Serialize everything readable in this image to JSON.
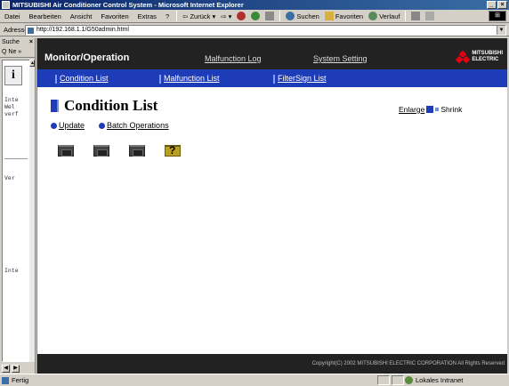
{
  "window": {
    "title": "MITSUBISHI Air Conditioner Control System - Microsoft Internet Explorer",
    "controls": [
      "_",
      "×"
    ]
  },
  "menubar": {
    "items": [
      "Datei",
      "Bearbeiten",
      "Ansicht",
      "Favoriten",
      "Extras",
      "?"
    ],
    "back_label": "⇦ Zurück ▾",
    "forward_label": "⇨ ▾",
    "search_label": "Suchen",
    "favorites_label": "Favoriten",
    "history_label": "Verlauf"
  },
  "addressbar": {
    "label": "Adresse",
    "url": "http://192.168.1.1/G50admin.html"
  },
  "sidebar": {
    "title": "Suche",
    "new_label": "Q Ne »",
    "info_glyph": "i",
    "text1": "Inte\nWel\nverf",
    "text2": "Ver",
    "text3": "Inte"
  },
  "page": {
    "app_title": "Monitor/Operation",
    "nav": [
      "Malfunction Log",
      "System Setting"
    ],
    "brand": [
      "MITSUBISHI",
      "ELECTRIC"
    ],
    "subnav": [
      "Condition List",
      "Malfunction List",
      "FilterSign List"
    ],
    "heading": "Condition List",
    "enlarge_label": "Enlarge",
    "shrink_label": "Shrink",
    "actions": [
      "Update",
      "Batch Operations"
    ],
    "units": [
      {
        "status": "normal"
      },
      {
        "status": "normal"
      },
      {
        "status": "normal"
      },
      {
        "status": "unknown",
        "glyph": "?"
      }
    ],
    "copyright": "Copyright(C) 2002 MITSUBISHI ELECTRIC CORPORATION All Rights Reserved"
  },
  "statusbar": {
    "status": "Fertig",
    "zone": "Lokales Intranet"
  }
}
